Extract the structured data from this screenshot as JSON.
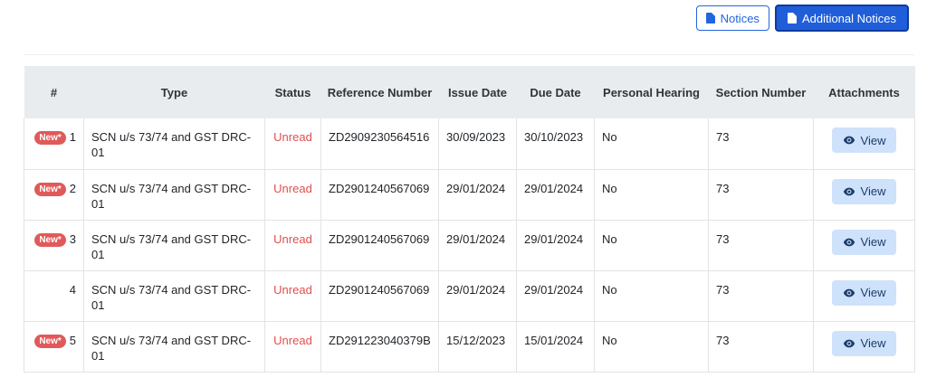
{
  "toolbar": {
    "notices_label": "Notices",
    "additional_notices_label": "Additional Notices"
  },
  "colors": {
    "primary": "#1f5ed8",
    "unread": "#e04f4f",
    "badge": "#e05a5a",
    "view_button_bg": "#cfe2fb"
  },
  "table": {
    "headers": {
      "num": "#",
      "type": "Type",
      "status": "Status",
      "reference": "Reference Number",
      "issue_date": "Issue Date",
      "due_date": "Due Date",
      "hearing": "Personal Hearing",
      "section": "Section Number",
      "attachments": "Attachments"
    },
    "new_badge_label": "New*",
    "view_label": "View",
    "rows": [
      {
        "num": "1",
        "is_new": true,
        "type": "SCN u/s 73/74 and GST DRC-01",
        "status": "Unread",
        "reference": "ZD2909230564516",
        "issue_date": "30/09/2023",
        "due_date": "30/10/2023",
        "hearing": "No",
        "section": "73"
      },
      {
        "num": "2",
        "is_new": true,
        "type": "SCN u/s 73/74 and GST DRC-01",
        "status": "Unread",
        "reference": "ZD2901240567069",
        "issue_date": "29/01/2024",
        "due_date": "29/01/2024",
        "hearing": "No",
        "section": "73"
      },
      {
        "num": "3",
        "is_new": true,
        "type": "SCN u/s 73/74 and GST DRC-01",
        "status": "Unread",
        "reference": "ZD2901240567069",
        "issue_date": "29/01/2024",
        "due_date": "29/01/2024",
        "hearing": "No",
        "section": "73"
      },
      {
        "num": "4",
        "is_new": false,
        "type": "SCN u/s 73/74 and GST DRC-01",
        "status": "Unread",
        "reference": "ZD2901240567069",
        "issue_date": "29/01/2024",
        "due_date": "29/01/2024",
        "hearing": "No",
        "section": "73"
      },
      {
        "num": "5",
        "is_new": true,
        "type": "SCN u/s 73/74 and GST DRC-01",
        "status": "Unread",
        "reference": "ZD291223040379B",
        "issue_date": "15/12/2023",
        "due_date": "15/01/2024",
        "hearing": "No",
        "section": "73"
      }
    ]
  }
}
